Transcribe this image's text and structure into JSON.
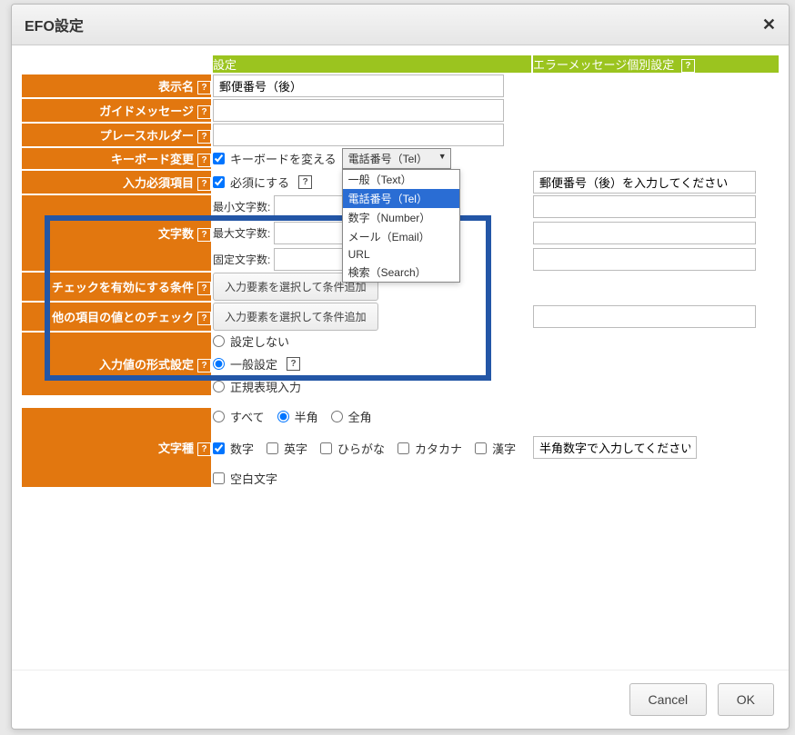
{
  "dialog": {
    "title": "EFO設定"
  },
  "columns": {
    "settings": "設定",
    "error": "エラーメッセージ個別設定"
  },
  "rows": {
    "display_name": {
      "label": "表示名",
      "value": "郵便番号（後）"
    },
    "guide_message": {
      "label": "ガイドメッセージ",
      "value": ""
    },
    "placeholder": {
      "label": "プレースホルダー",
      "value": ""
    },
    "keyboard": {
      "label": "キーボード変更",
      "checkbox": "キーボードを変える",
      "checked": true,
      "selected": "電話番号（Tel）",
      "options": [
        "一般（Text）",
        "電話番号（Tel）",
        "数字（Number）",
        "メール（Email）",
        "URL",
        "検索（Search）"
      ]
    },
    "required": {
      "label": "入力必須項目",
      "checkbox": "必須にする",
      "checked": true,
      "error_value": "郵便番号（後）を入力してください"
    },
    "length": {
      "label": "文字数",
      "min_label": "最小文字数:",
      "max_label": "最大文字数:",
      "fixed_label": "固定文字数:",
      "min": "",
      "max": "",
      "fixed": "",
      "err_min": "",
      "err_max": "",
      "err_fixed": ""
    },
    "check_cond": {
      "label": "チェックを有効にする条件",
      "button": "入力要素を選択して条件追加"
    },
    "other_check": {
      "label": "他の項目の値とのチェック",
      "button": "入力要素を選択して条件追加",
      "error_value": ""
    },
    "format": {
      "label": "入力値の形式設定",
      "opts": {
        "none": "設定しない",
        "general": "一般設定",
        "regex": "正規表現入力"
      },
      "selected": "general"
    },
    "char_type": {
      "label": "文字種",
      "width_opts": {
        "all": "すべて",
        "half": "半角",
        "full": "全角"
      },
      "width_selected": "half",
      "kinds": {
        "digit": "数字",
        "alpha": "英字",
        "hira": "ひらがな",
        "kata": "カタカナ",
        "kanji": "漢字",
        "space": "空白文字"
      },
      "kinds_checked": {
        "digit": true,
        "alpha": false,
        "hira": false,
        "kata": false,
        "kanji": false,
        "space": false
      },
      "error_value": "半角数字で入力してください"
    }
  },
  "footer": {
    "cancel": "Cancel",
    "ok": "OK"
  }
}
